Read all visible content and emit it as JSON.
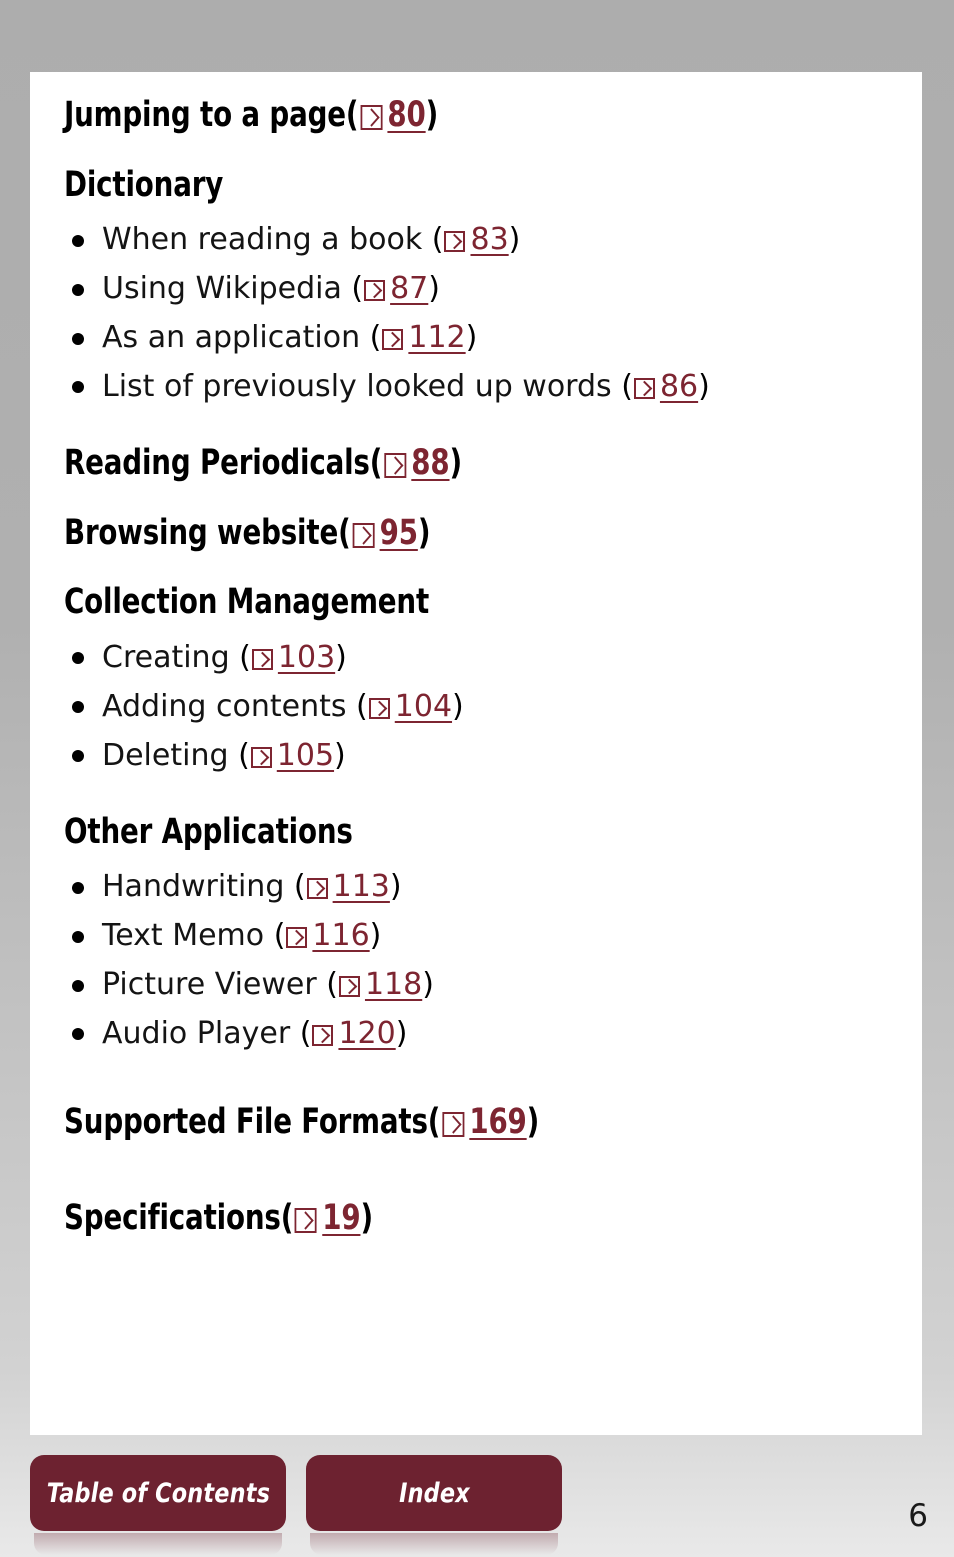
{
  "page": {
    "number": "6",
    "background_color": "#adadad",
    "sheet_color": "#ffffff",
    "accent_color": "#7d2531",
    "button_color": "#6d2230"
  },
  "ref_icon_name": "jump-to-page-arrow-icon",
  "content": [
    {
      "type": "heading",
      "label": "Jumping to a page",
      "open_paren": "(",
      "page_ref": "80",
      "close_paren": ")"
    },
    {
      "type": "heading",
      "label": "Dictionary",
      "open_paren": "",
      "page_ref": "",
      "close_paren": ""
    },
    {
      "type": "list",
      "items": [
        {
          "label": "When reading a book",
          "open_paren": "(",
          "page_ref": "83",
          "close_paren": ")"
        },
        {
          "label": "Using Wikipedia",
          "open_paren": "(",
          "page_ref": "87",
          "close_paren": ")"
        },
        {
          "label": "As an application",
          "open_paren": "(",
          "page_ref": "112",
          "close_paren": ")"
        },
        {
          "label": "List of previously looked up words",
          "open_paren": "(",
          "page_ref": "86",
          "close_paren": ")"
        }
      ]
    },
    {
      "type": "heading",
      "label": "Reading Periodicals",
      "open_paren": "(",
      "page_ref": "88",
      "close_paren": ")"
    },
    {
      "type": "heading",
      "label": "Browsing website",
      "open_paren": "(",
      "page_ref": "95",
      "close_paren": ")"
    },
    {
      "type": "heading",
      "label": "Collection Management",
      "open_paren": "",
      "page_ref": "",
      "close_paren": ""
    },
    {
      "type": "list",
      "items": [
        {
          "label": "Creating",
          "open_paren": "(",
          "page_ref": "103",
          "close_paren": ")"
        },
        {
          "label": "Adding contents",
          "open_paren": "(",
          "page_ref": "104",
          "close_paren": ")"
        },
        {
          "label": "Deleting",
          "open_paren": "(",
          "page_ref": "105",
          "close_paren": ")"
        }
      ]
    },
    {
      "type": "heading",
      "label": "Other Applications",
      "open_paren": "",
      "page_ref": "",
      "close_paren": ""
    },
    {
      "type": "list",
      "items": [
        {
          "label": "Handwriting",
          "open_paren": "(",
          "page_ref": "113",
          "close_paren": ")"
        },
        {
          "label": "Text Memo",
          "open_paren": "(",
          "page_ref": "116",
          "close_paren": ")"
        },
        {
          "label": "Picture Viewer",
          "open_paren": "(",
          "page_ref": "118",
          "close_paren": ")"
        },
        {
          "label": "Audio Player",
          "open_paren": "(",
          "page_ref": "120",
          "close_paren": ")"
        }
      ]
    },
    {
      "type": "heading",
      "label": "Supported File Formats",
      "open_paren": "(",
      "page_ref": "169",
      "close_paren": ")"
    },
    {
      "type": "heading",
      "label": "Specifications",
      "open_paren": "(",
      "page_ref": "19",
      "close_paren": ")"
    }
  ],
  "nav": {
    "table_of_contents_label": "Table of Contents",
    "index_label": "Index"
  }
}
